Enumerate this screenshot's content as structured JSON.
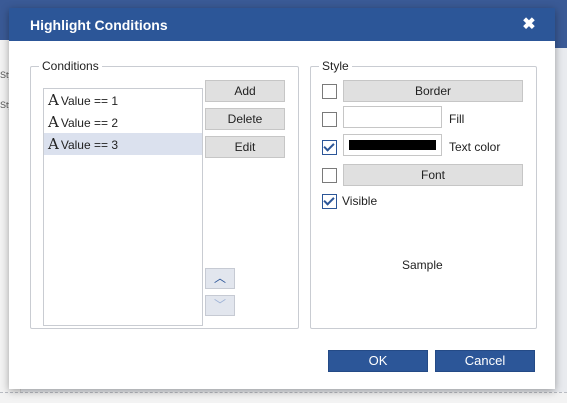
{
  "dialog": {
    "title": "Highlight Conditions",
    "close_glyph": "✖"
  },
  "conditions": {
    "legend": "Conditions",
    "items": [
      {
        "icon": "A",
        "label": "Value == 1"
      },
      {
        "icon": "A",
        "label": "Value == 2"
      },
      {
        "icon": "A",
        "label": "Value == 3",
        "selected": true
      }
    ],
    "add_label": "Add",
    "delete_label": "Delete",
    "edit_label": "Edit",
    "up_glyph": "︿",
    "down_glyph": "﹀"
  },
  "style": {
    "legend": "Style",
    "border": {
      "checked": false,
      "label": "Border"
    },
    "fill": {
      "checked": false,
      "label": "Fill",
      "color": ""
    },
    "text_color": {
      "checked": true,
      "label": "Text color",
      "color": "#000000"
    },
    "font": {
      "checked": false,
      "label": "Font"
    },
    "visible": {
      "checked": true,
      "label": "Visible"
    },
    "sample_label": "Sample"
  },
  "footer": {
    "ok_label": "OK",
    "cancel_label": "Cancel"
  },
  "background": {
    "stub_top": "Styl",
    "stub_mid": "Sty"
  },
  "colors": {
    "accent": "#2c5698",
    "selection": "#dbe1ee"
  }
}
